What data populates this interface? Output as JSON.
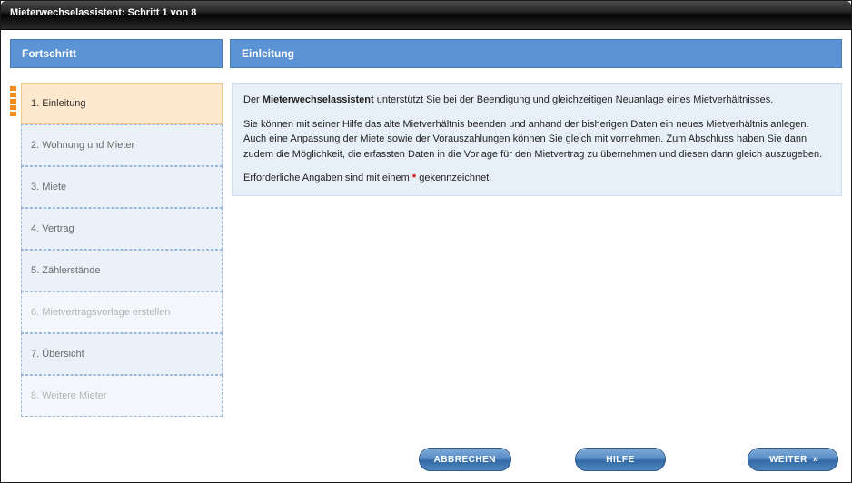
{
  "window": {
    "title": "Mieterwechselassistent: Schritt 1 von 8"
  },
  "headers": {
    "progress": "Fortschritt",
    "main": "Einleitung"
  },
  "steps": [
    {
      "label": "1. Einleitung",
      "state": "active"
    },
    {
      "label": "2. Wohnung und Mieter",
      "state": "normal"
    },
    {
      "label": "3. Miete",
      "state": "normal"
    },
    {
      "label": "4. Vertrag",
      "state": "normal"
    },
    {
      "label": "5. Zählerstände",
      "state": "normal"
    },
    {
      "label": "6. Mietvertragsvorlage erstellen",
      "state": "disabled"
    },
    {
      "label": "7. Übersicht",
      "state": "normal"
    },
    {
      "label": "8. Weitere Mieter",
      "state": "disabled"
    }
  ],
  "intro": {
    "p1_prefix": "Der ",
    "p1_bold": "Mieterwechselassistent",
    "p1_rest": " unterstützt Sie bei der Beendigung und gleichzeitigen Neuanlage eines Mietverhältnisses.",
    "p2": "Sie können mit seiner Hilfe das alte Mietverhältnis beenden und anhand der bisherigen Daten ein neues Mietverhältnis anlegen. Auch eine Anpassung der Miete sowie der Vorauszahlungen können Sie gleich mit vornehmen. Zum Abschluss haben Sie dann zudem die Möglichkeit, die erfassten Daten in die Vorlage für den Mietvertrag zu übernehmen und diesen dann gleich auszugeben.",
    "p3_before": "Erforderliche Angaben sind mit einem ",
    "p3_star": "*",
    "p3_after": " gekennzeichnet."
  },
  "buttons": {
    "cancel": "ABBRECHEN",
    "help": "HILFE",
    "next": "WEITER"
  }
}
